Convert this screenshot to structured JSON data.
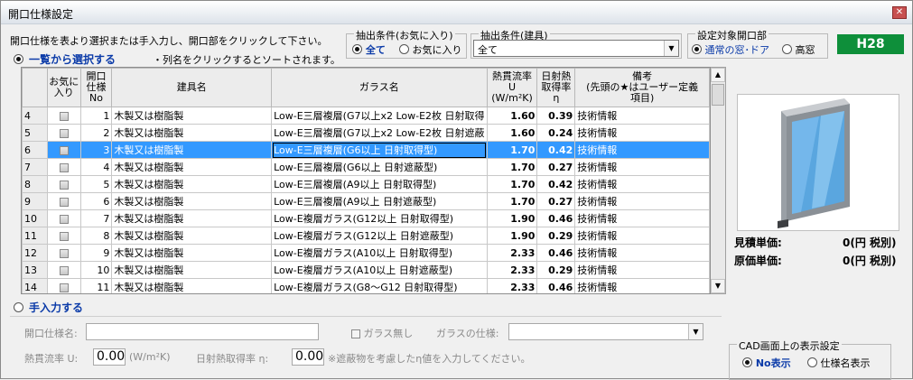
{
  "window": {
    "title": "開口仕様設定",
    "close_symbol": "✕"
  },
  "instruction": "開口仕様を表より選択または手入力し、開口部をクリックして下さい。",
  "mode_list": {
    "label": "一覧から選択する",
    "selected": true
  },
  "sort_hint": "・列名をクリックするとソートされます。",
  "filter_fav": {
    "title": "抽出条件(お気に入り)",
    "options": [
      "全て",
      "お気に入り"
    ],
    "selected": "全て"
  },
  "filter_fixture": {
    "title": "抽出条件(建具)",
    "value": "全て"
  },
  "target_opening": {
    "title": "設定対象開口部",
    "options": [
      "通常の窓･ドア",
      "高窓"
    ],
    "selected": "通常の窓･ドア"
  },
  "standard_badge": "H28",
  "table": {
    "headers": [
      "お気に\n入り",
      "開口\n仕様\nNo",
      "建具名",
      "ガラス名",
      "熱貫流率\nU\n(W/m²K)",
      "日射熱\n取得率\nη",
      "備考\n(先頭の★はユーザー定義\n項目)"
    ],
    "rows": [
      {
        "row": "4",
        "no": "1",
        "fixture": "木製又は樹脂製",
        "glass": "Low-E三層複層(G7以上x2 Low-E2枚 日射取得",
        "u": "1.60",
        "eta": "0.39",
        "note": "技術情報"
      },
      {
        "row": "5",
        "no": "2",
        "fixture": "木製又は樹脂製",
        "glass": "Low-E三層複層(G7以上x2 Low-E2枚 日射遮蔽",
        "u": "1.60",
        "eta": "0.24",
        "note": "技術情報"
      },
      {
        "row": "6",
        "no": "3",
        "fixture": "木製又は樹脂製",
        "glass": "Low-E三層複層(G6以上 日射取得型)",
        "u": "1.70",
        "eta": "0.42",
        "note": "技術情報"
      },
      {
        "row": "7",
        "no": "4",
        "fixture": "木製又は樹脂製",
        "glass": "Low-E三層複層(G6以上 日射遮蔽型)",
        "u": "1.70",
        "eta": "0.27",
        "note": "技術情報"
      },
      {
        "row": "8",
        "no": "5",
        "fixture": "木製又は樹脂製",
        "glass": "Low-E三層複層(A9以上 日射取得型)",
        "u": "1.70",
        "eta": "0.42",
        "note": "技術情報"
      },
      {
        "row": "9",
        "no": "6",
        "fixture": "木製又は樹脂製",
        "glass": "Low-E三層複層(A9以上 日射遮蔽型)",
        "u": "1.70",
        "eta": "0.27",
        "note": "技術情報"
      },
      {
        "row": "10",
        "no": "7",
        "fixture": "木製又は樹脂製",
        "glass": "Low-E複層ガラス(G12以上 日射取得型)",
        "u": "1.90",
        "eta": "0.46",
        "note": "技術情報"
      },
      {
        "row": "11",
        "no": "8",
        "fixture": "木製又は樹脂製",
        "glass": "Low-E複層ガラス(G12以上 日射遮蔽型)",
        "u": "1.90",
        "eta": "0.29",
        "note": "技術情報"
      },
      {
        "row": "12",
        "no": "9",
        "fixture": "木製又は樹脂製",
        "glass": "Low-E複層ガラス(A10以上 日射取得型)",
        "u": "2.33",
        "eta": "0.46",
        "note": "技術情報"
      },
      {
        "row": "13",
        "no": "10",
        "fixture": "木製又は樹脂製",
        "glass": "Low-E複層ガラス(A10以上 日射遮蔽型)",
        "u": "2.33",
        "eta": "0.29",
        "note": "技術情報"
      },
      {
        "row": "14",
        "no": "11",
        "fixture": "木製又は樹脂製",
        "glass": "Low-E複層ガラス(G8～G12 日射取得型)",
        "u": "2.33",
        "eta": "0.46",
        "note": "技術情報"
      }
    ],
    "selected_row": "6"
  },
  "prices": {
    "estimate_label": "見積単価:",
    "estimate_value": "0(円 税別)",
    "cost_label": "原価単価:",
    "cost_value": "0(円 税別)"
  },
  "mode_manual": {
    "label": "手入力する",
    "selected": false
  },
  "manual": {
    "spec_name_label": "開口仕様名:",
    "spec_name_value": "",
    "no_glass_label": "ガラス無し",
    "glass_spec_label": "ガラスの仕様:",
    "glass_spec_value": "",
    "u_label": "熱貫流率 U:",
    "u_value": "0.00",
    "u_unit": "(W/m²K)",
    "eta_label": "日射熱取得率 η:",
    "eta_value": "0.00",
    "eta_note": "※遮蔽物を考慮したη値を入力してください。"
  },
  "cad": {
    "title": "CAD画面上の表示設定",
    "options": [
      "No表示",
      "仕様名表示"
    ],
    "selected": "No表示"
  },
  "icons": {
    "checkbox": "checkbox-icon",
    "dropdown": "chevron-down-icon",
    "window_preview": "window-preview-image"
  }
}
